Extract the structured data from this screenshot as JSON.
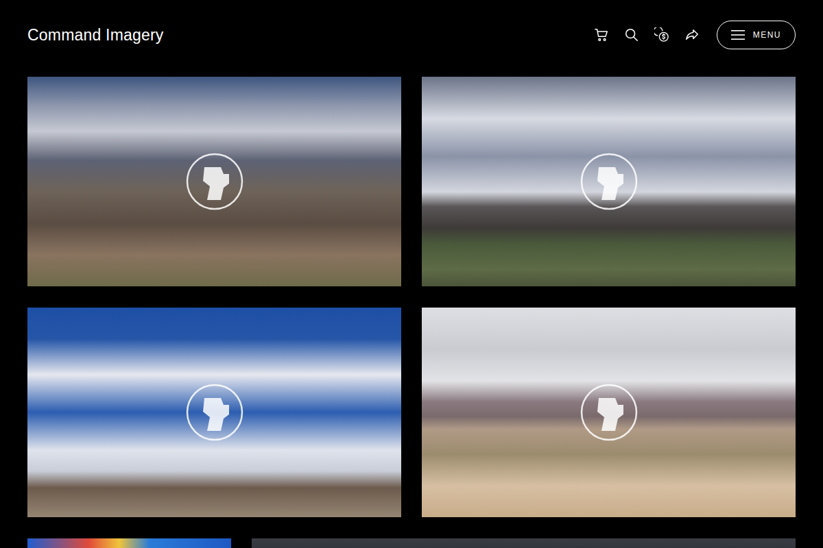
{
  "header": {
    "title": "Command Imagery",
    "menu_button": "MENU"
  }
}
